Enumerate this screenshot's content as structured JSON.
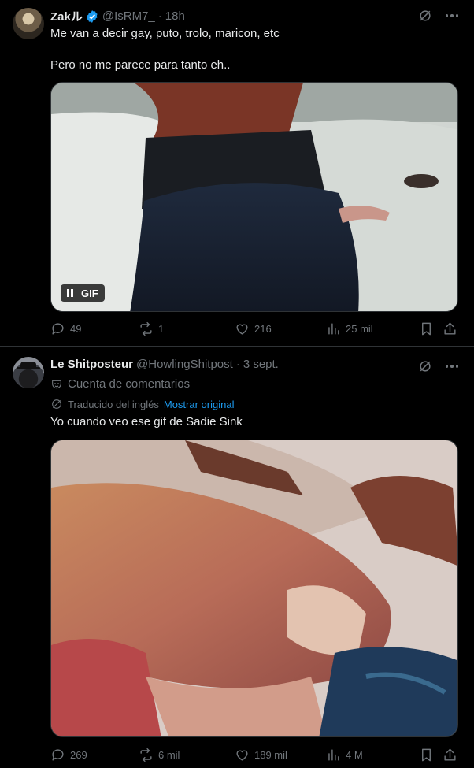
{
  "tweets": [
    {
      "name": "Zakル",
      "handle": "@IsRM7_",
      "time": "18h",
      "text_line1": "Me van a decir gay, puto, trolo, maricon, etc",
      "text_line2": "Pero no me parece para tanto eh..",
      "gif_label": "GIF",
      "stats": {
        "replies": "49",
        "retweets": "1",
        "likes": "216",
        "views": "25 mil"
      },
      "icons": [
        "grok-icon",
        "more-icon",
        "verified-badge-icon",
        "pause-icon",
        "reply-icon",
        "retweet-icon",
        "like-icon",
        "views-icon",
        "bookmark-icon",
        "share-icon"
      ],
      "colors": {
        "verified": "#1d9bf0"
      }
    },
    {
      "name": "Le Shitposteur",
      "handle": "@HowlingShitpost",
      "time": "3 sept.",
      "account_label": "Cuenta de comentarios",
      "translated_label": "Traducido del inglés",
      "show_original": "Mostrar original",
      "text": "Yo cuando veo ese gif de Sadie Sink",
      "stats": {
        "replies": "269",
        "retweets": "6 mil",
        "likes": "189 mil",
        "views": "4 M"
      },
      "icons": [
        "parody-mask-icon",
        "translate-icon",
        "grok-icon",
        "more-icon",
        "reply-icon",
        "retweet-icon",
        "like-icon",
        "views-icon",
        "bookmark-icon",
        "share-icon"
      ],
      "colors": {
        "link": "#1d9bf0"
      }
    }
  ]
}
